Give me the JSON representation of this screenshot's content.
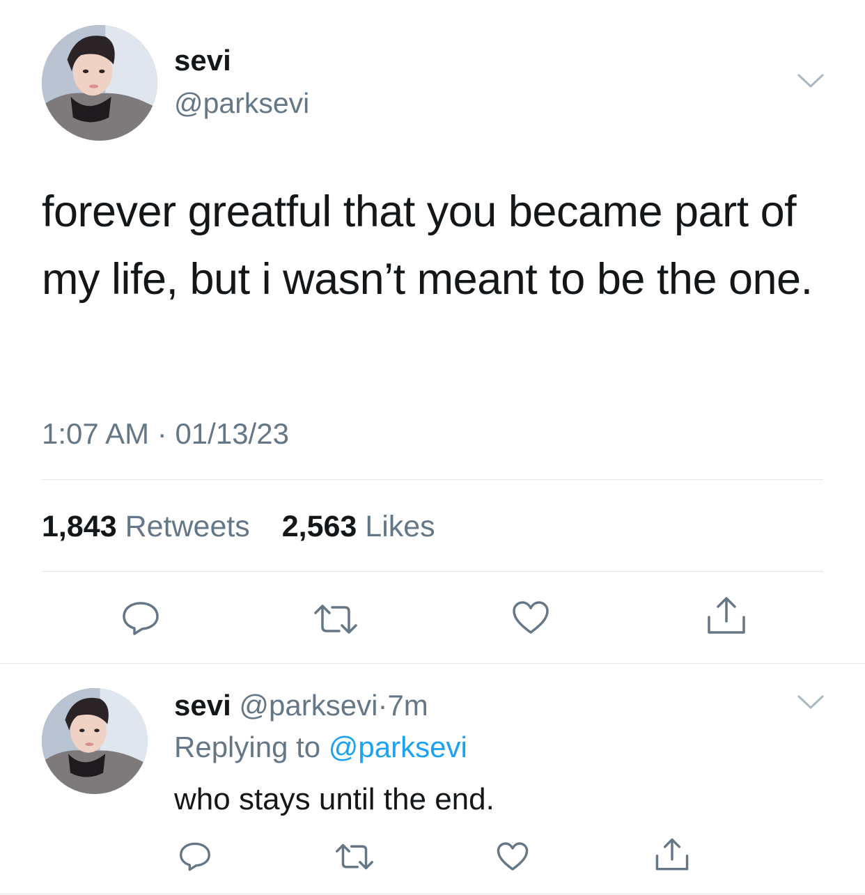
{
  "tweet": {
    "display_name": "sevi",
    "handle": "@parksevi",
    "text": "forever greatful that you became part of my life, but i wasn’t meant to be the one.",
    "time": "1:07 AM",
    "separator": "·",
    "date": "01/13/23",
    "retweets_count": "1,843",
    "retweets_label": "Retweets",
    "likes_count": "2,563",
    "likes_label": "Likes",
    "actions": [
      "reply-icon",
      "retweet-icon",
      "like-icon",
      "share-icon"
    ],
    "menu_icon": "chevron-down-icon"
  },
  "reply": {
    "display_name": "sevi",
    "handle": "@parksevi",
    "dot": "·",
    "age": "7m",
    "replying_prefix": "Replying to",
    "replying_to": "@parksevi",
    "text": "who stays until the end.",
    "actions": [
      "reply-icon",
      "retweet-icon",
      "like-icon",
      "share-icon"
    ],
    "menu_icon": "chevron-down-icon"
  },
  "colors": {
    "text_primary": "#14171a",
    "text_secondary": "#657786",
    "link": "#1da1f2",
    "icon": "#657786",
    "divider": "#e1e8ed"
  }
}
